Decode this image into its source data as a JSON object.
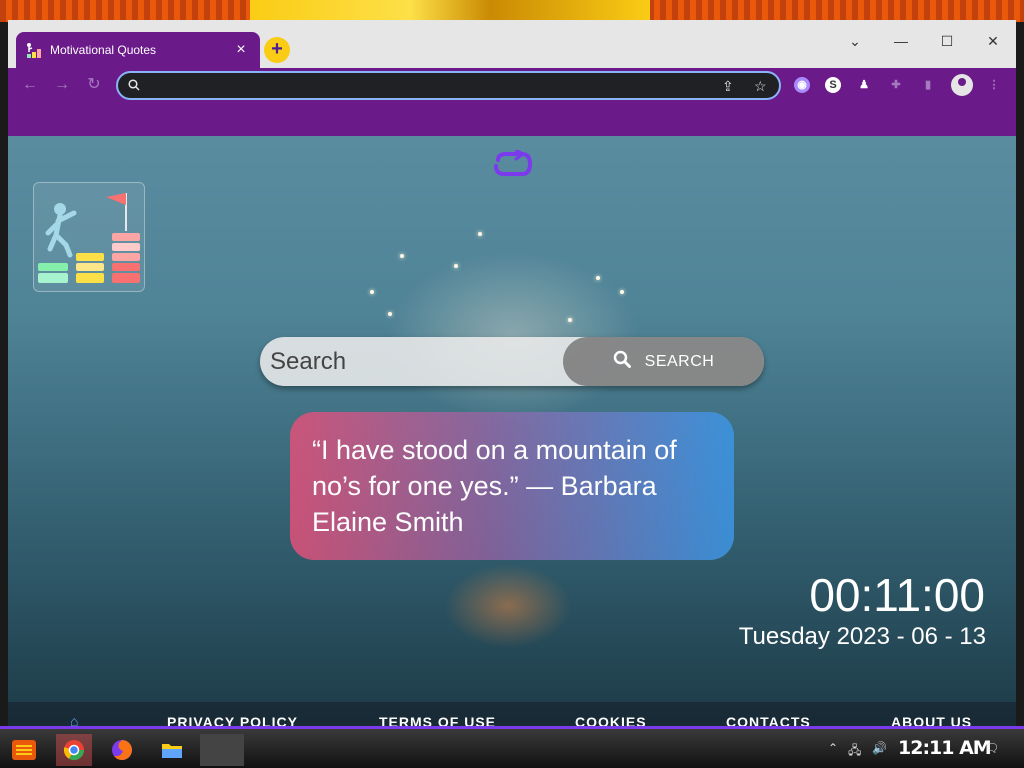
{
  "browser": {
    "tab_title": "Motivational Quotes",
    "tab_close": "×",
    "new_tab": "+",
    "window_controls": {
      "minimize": "—",
      "maximize": "☐",
      "close": "✕"
    },
    "omnibox_value": ""
  },
  "page": {
    "search": {
      "placeholder": "Search",
      "button_label": "SEARCH"
    },
    "quote": "“I have stood on a mountain of no’s for one yes.” — Barbara Elaine Smith",
    "clock": {
      "time": "00:11:00",
      "date": "Tuesday 2023 - 06 - 13"
    },
    "footer": {
      "links": [
        "PRIVACY POLICY",
        "TERMS OF USE",
        "COOKIES",
        "CONTACTS",
        "ABOUT US"
      ]
    }
  },
  "taskbar": {
    "clock": "12:11 AM"
  },
  "colors": {
    "browser_theme": "#6b1a8a",
    "omnibox_focus": "#8ab4f8",
    "quote_gradient_start": "#e25078",
    "quote_gradient_end": "#3c96e6"
  }
}
